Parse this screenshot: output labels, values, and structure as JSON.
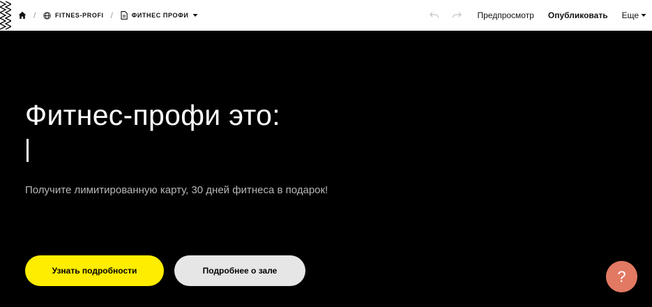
{
  "topbar": {
    "breadcrumbs": [
      {
        "icon": "home-icon",
        "label": ""
      },
      {
        "icon": "globe-icon",
        "label": "FITNES-PROFI"
      },
      {
        "icon": "page-icon",
        "label": "ФИТНЕС ПРОФИ"
      }
    ],
    "preview_label": "Предпросмотр",
    "publish_label": "Опубликовать",
    "more_label": "Еще"
  },
  "hero": {
    "title": "Фитнес-профи это:",
    "subtitle": "Получите лимитированную карту, 30 дней фитнеса в подарок!",
    "primary_button": "Узнать подробности",
    "secondary_button": "Подробнее о зале",
    "help_label": "?"
  },
  "colors": {
    "background": "#000000",
    "primary_button": "#ffed00",
    "secondary_button": "#e6e6e6",
    "help_button": "#e27963"
  }
}
